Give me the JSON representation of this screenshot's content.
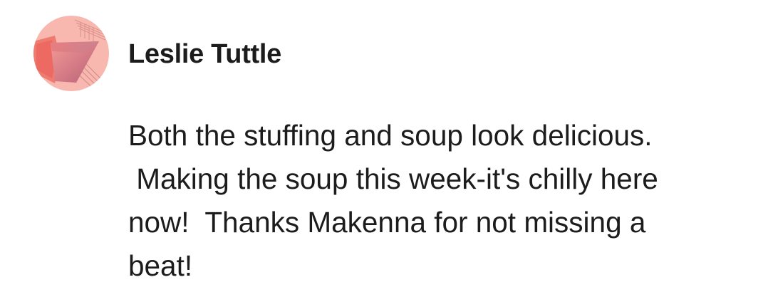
{
  "comment": {
    "author": {
      "name": "Leslie Tuttle",
      "avatar_icon": "geometric-pink-avatar",
      "avatar_colors": [
        "#f7b3ac",
        "#e96b66",
        "#c9868c",
        "#f19a8f"
      ]
    },
    "body": "Both the stuffing and soup look delicious.\n Making the soup this week-it's chilly here\nnow!  Thanks Makenna for not missing a\nbeat!"
  }
}
